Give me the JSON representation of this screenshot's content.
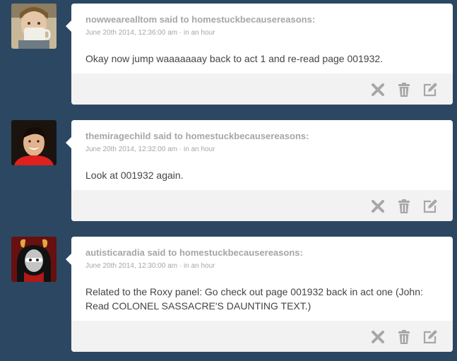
{
  "posts": [
    {
      "asker": "nowwearealltom",
      "said_to_text": "said to",
      "recipient": "homestuckbecausereasons:",
      "date": "June 20th 2014, 12:36:00 am",
      "separator": "·",
      "publish": "in an hour",
      "question": "Okay now jump waaaaaaay back to act 1 and re-read page 001932.",
      "avatar_icon": "avatar-person-drinking-mug"
    },
    {
      "asker": "themiragechild",
      "said_to_text": "said to",
      "recipient": "homestuckbecausereasons:",
      "date": "June 20th 2014, 12:32:00 am",
      "separator": "·",
      "publish": "in an hour",
      "question": "Look at 001932 again.",
      "avatar_icon": "avatar-smiling-person-red-shirt"
    },
    {
      "asker": "autisticaradia",
      "said_to_text": "said to",
      "recipient": "homestuckbecausereasons:",
      "date": "June 20th 2014, 12:30:00 am",
      "separator": "·",
      "publish": "in an hour",
      "question": "Related to the Roxy panel: Go check out page 001932 back in act one (John: Read COLONEL SASSACRE'S DAUNTING TEXT.)",
      "avatar_icon": "avatar-aradia-cosplay"
    }
  ],
  "actions": {
    "delete_icon": "x-delete-icon",
    "trash_icon": "trash-icon",
    "edit_icon": "edit-pencil-icon"
  },
  "colors": {
    "background": "#2c4762",
    "card": "#ffffff",
    "action_bar": "#f2f2f2",
    "meta_text": "#a6a6a6",
    "body_text": "#444444",
    "icon": "#a7a7a7"
  }
}
